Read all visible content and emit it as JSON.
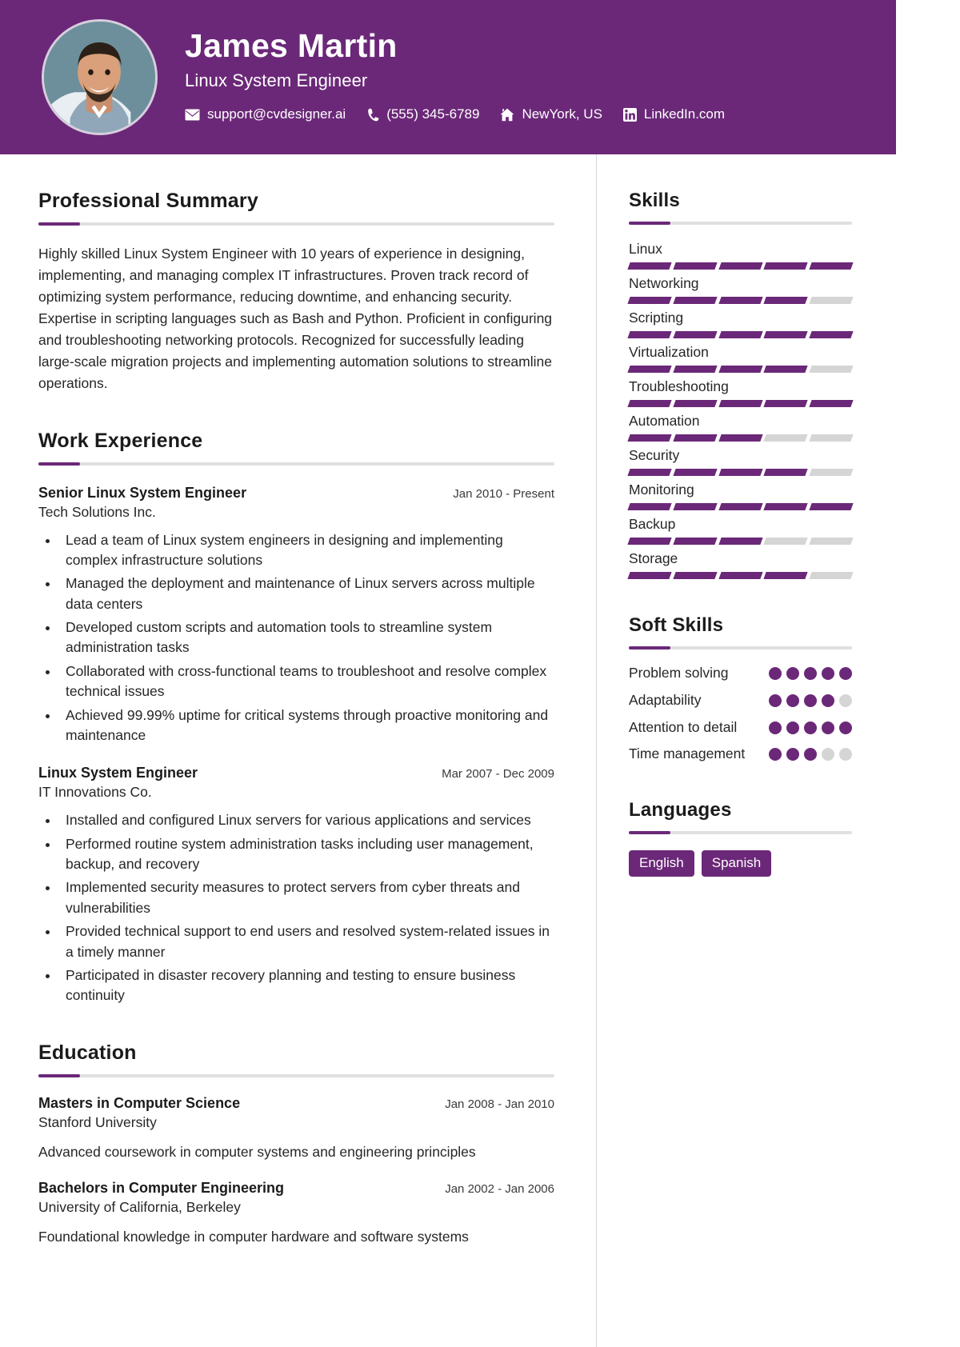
{
  "theme": {
    "accent": "#6b2878",
    "muted": "#d5d5d5",
    "text": "#262626"
  },
  "header": {
    "name": "James Martin",
    "title": "Linux System Engineer",
    "avatar_alt": "profile-photo",
    "contacts": [
      {
        "icon": "envelope-icon",
        "label": "support@cvdesigner.ai"
      },
      {
        "icon": "phone-icon",
        "label": "(555) 345-6789"
      },
      {
        "icon": "home-icon",
        "label": "NewYork, US"
      },
      {
        "icon": "linkedin-icon",
        "label": "LinkedIn.com"
      }
    ]
  },
  "main": {
    "summary": {
      "heading": "Professional Summary",
      "text": "Highly skilled Linux System Engineer with 10 years of experience in designing, implementing, and managing complex IT infrastructures. Proven track record of optimizing system performance, reducing downtime, and enhancing security. Expertise in scripting languages such as Bash and Python. Proficient in configuring and troubleshooting networking protocols. Recognized for successfully leading large-scale migration projects and implementing automation solutions to streamline operations."
    },
    "work": {
      "heading": "Work Experience",
      "jobs": [
        {
          "title": "Senior Linux System Engineer",
          "date": "Jan 2010 - Present",
          "org": "Tech Solutions Inc.",
          "bullets": [
            "Lead a team of Linux system engineers in designing and implementing complex infrastructure solutions",
            "Managed the deployment and maintenance of Linux servers across multiple data centers",
            "Developed custom scripts and automation tools to streamline system administration tasks",
            "Collaborated with cross-functional teams to troubleshoot and resolve complex technical issues",
            "Achieved 99.99% uptime for critical systems through proactive monitoring and maintenance"
          ]
        },
        {
          "title": "Linux System Engineer",
          "date": "Mar 2007 - Dec 2009",
          "org": "IT Innovations Co.",
          "bullets": [
            "Installed and configured Linux servers for various applications and services",
            "Performed routine system administration tasks including user management, backup, and recovery",
            "Implemented security measures to protect servers from cyber threats and vulnerabilities",
            "Provided technical support to end users and resolved system-related issues in a timely manner",
            "Participated in disaster recovery planning and testing to ensure business continuity"
          ]
        }
      ]
    },
    "education": {
      "heading": "Education",
      "items": [
        {
          "title": "Masters in Computer Science",
          "date": "Jan 2008 - Jan 2010",
          "org": "Stanford University",
          "desc": "Advanced coursework in computer systems and engineering principles"
        },
        {
          "title": "Bachelors in Computer Engineering",
          "date": "Jan 2002 - Jan 2006",
          "org": "University of California, Berkeley",
          "desc": "Foundational knowledge in computer hardware and software systems"
        }
      ]
    }
  },
  "sidebar": {
    "skills": {
      "heading": "Skills",
      "max": 5,
      "items": [
        {
          "label": "Linux",
          "level": 5
        },
        {
          "label": "Networking",
          "level": 4
        },
        {
          "label": "Scripting",
          "level": 5
        },
        {
          "label": "Virtualization",
          "level": 4
        },
        {
          "label": "Troubleshooting",
          "level": 5
        },
        {
          "label": "Automation",
          "level": 3
        },
        {
          "label": "Security",
          "level": 4
        },
        {
          "label": "Monitoring",
          "level": 5
        },
        {
          "label": "Backup",
          "level": 3
        },
        {
          "label": "Storage",
          "level": 4
        }
      ]
    },
    "soft_skills": {
      "heading": "Soft Skills",
      "max": 5,
      "items": [
        {
          "label": "Problem solving",
          "level": 5
        },
        {
          "label": "Adaptability",
          "level": 4
        },
        {
          "label": "Attention to detail",
          "level": 5
        },
        {
          "label": "Time management",
          "level": 3
        }
      ]
    },
    "languages": {
      "heading": "Languages",
      "items": [
        "English",
        "Spanish"
      ]
    }
  }
}
